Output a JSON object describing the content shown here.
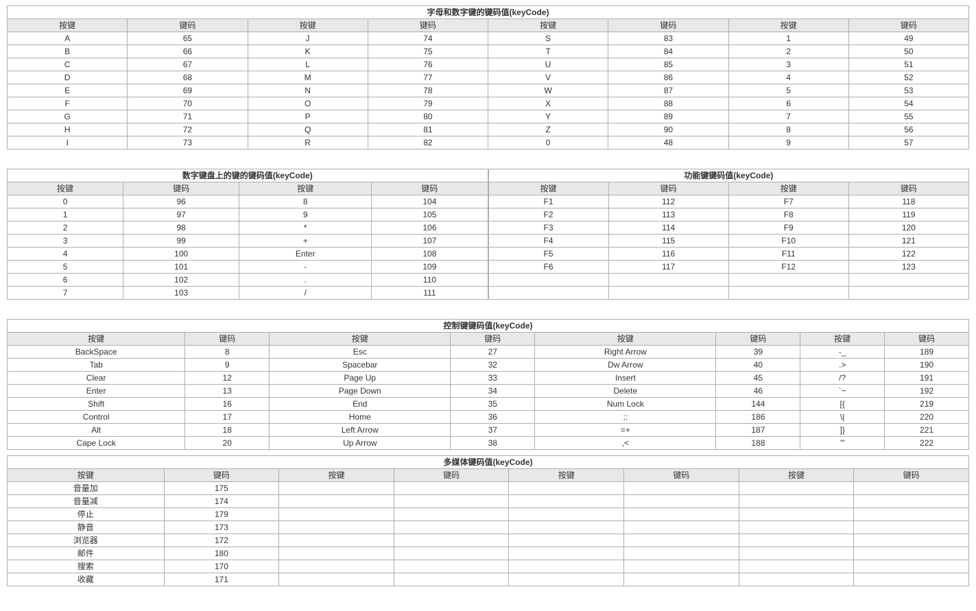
{
  "labels": {
    "col_key": "按键",
    "col_code": "键码"
  },
  "table_alpha": {
    "title": "字母和数字键的键码值(keyCode)",
    "rows": [
      [
        "A",
        "65",
        "J",
        "74",
        "S",
        "83",
        "1",
        "49"
      ],
      [
        "B",
        "66",
        "K",
        "75",
        "T",
        "84",
        "2",
        "50"
      ],
      [
        "C",
        "67",
        "L",
        "76",
        "U",
        "85",
        "3",
        "51"
      ],
      [
        "D",
        "68",
        "M",
        "77",
        "V",
        "86",
        "4",
        "52"
      ],
      [
        "E",
        "69",
        "N",
        "78",
        "W",
        "87",
        "5",
        "53"
      ],
      [
        "F",
        "70",
        "O",
        "79",
        "X",
        "88",
        "6",
        "54"
      ],
      [
        "G",
        "71",
        "P",
        "80",
        "Y",
        "89",
        "7",
        "55"
      ],
      [
        "H",
        "72",
        "Q",
        "81",
        "Z",
        "90",
        "8",
        "56"
      ],
      [
        "I",
        "73",
        "R",
        "82",
        "0",
        "48",
        "9",
        "57"
      ]
    ]
  },
  "table_numpad": {
    "title": "数字键盘上的键的键码值(keyCode)",
    "rows": [
      [
        "0",
        "96",
        "8",
        "104"
      ],
      [
        "1",
        "97",
        "9",
        "105"
      ],
      [
        "2",
        "98",
        "*",
        "106"
      ],
      [
        "3",
        "99",
        "+",
        "107"
      ],
      [
        "4",
        "100",
        "Enter",
        "108"
      ],
      [
        "5",
        "101",
        "-",
        "109"
      ],
      [
        "6",
        "102",
        ".",
        "110"
      ],
      [
        "7",
        "103",
        "/",
        "111"
      ]
    ]
  },
  "table_fn": {
    "title": "功能键键码值(keyCode)",
    "rows": [
      [
        "F1",
        "112",
        "F7",
        "118"
      ],
      [
        "F2",
        "113",
        "F8",
        "119"
      ],
      [
        "F3",
        "114",
        "F9",
        "120"
      ],
      [
        "F4",
        "115",
        "F10",
        "121"
      ],
      [
        "F5",
        "116",
        "F11",
        "122"
      ],
      [
        "F6",
        "117",
        "F12",
        "123"
      ],
      [
        "",
        "",
        "",
        ""
      ],
      [
        "",
        "",
        "",
        ""
      ]
    ]
  },
  "table_ctrl": {
    "title": "控制键键码值(keyCode)",
    "rows": [
      [
        "BackSpace",
        "8",
        "Esc",
        "27",
        "Right Arrow",
        "39",
        "-_",
        "189"
      ],
      [
        "Tab",
        "9",
        "Spacebar",
        "32",
        "Dw Arrow",
        "40",
        ".>",
        "190"
      ],
      [
        "Clear",
        "12",
        "Page Up",
        "33",
        "Insert",
        "45",
        "/?",
        "191"
      ],
      [
        "Enter",
        "13",
        "Page Down",
        "34",
        "Delete",
        "46",
        "`~",
        "192"
      ],
      [
        "Shift",
        "16",
        "End",
        "35",
        "Num Lock",
        "144",
        "[{",
        "219"
      ],
      [
        "Control",
        "17",
        "Home",
        "36",
        ";:",
        "186",
        "\\|",
        "220"
      ],
      [
        "Alt",
        "18",
        "Left Arrow",
        "37",
        "=+",
        "187",
        "]}",
        "221"
      ],
      [
        "Cape Lock",
        "20",
        "Up Arrow",
        "38",
        ",<",
        "188",
        "'\"",
        "222"
      ]
    ]
  },
  "table_media": {
    "title": "多媒体键码值(keyCode)",
    "rows": [
      [
        "音量加",
        "175",
        "",
        "",
        "",
        "",
        "",
        ""
      ],
      [
        "音量减",
        "174",
        "",
        "",
        "",
        "",
        "",
        ""
      ],
      [
        "停止",
        "179",
        "",
        "",
        "",
        "",
        "",
        ""
      ],
      [
        "静音",
        "173",
        "",
        "",
        "",
        "",
        "",
        ""
      ],
      [
        "浏览器",
        "172",
        "",
        "",
        "",
        "",
        "",
        ""
      ],
      [
        "邮件",
        "180",
        "",
        "",
        "",
        "",
        "",
        ""
      ],
      [
        "搜索",
        "170",
        "",
        "",
        "",
        "",
        "",
        ""
      ],
      [
        "收藏",
        "171",
        "",
        "",
        "",
        "",
        "",
        ""
      ]
    ]
  }
}
